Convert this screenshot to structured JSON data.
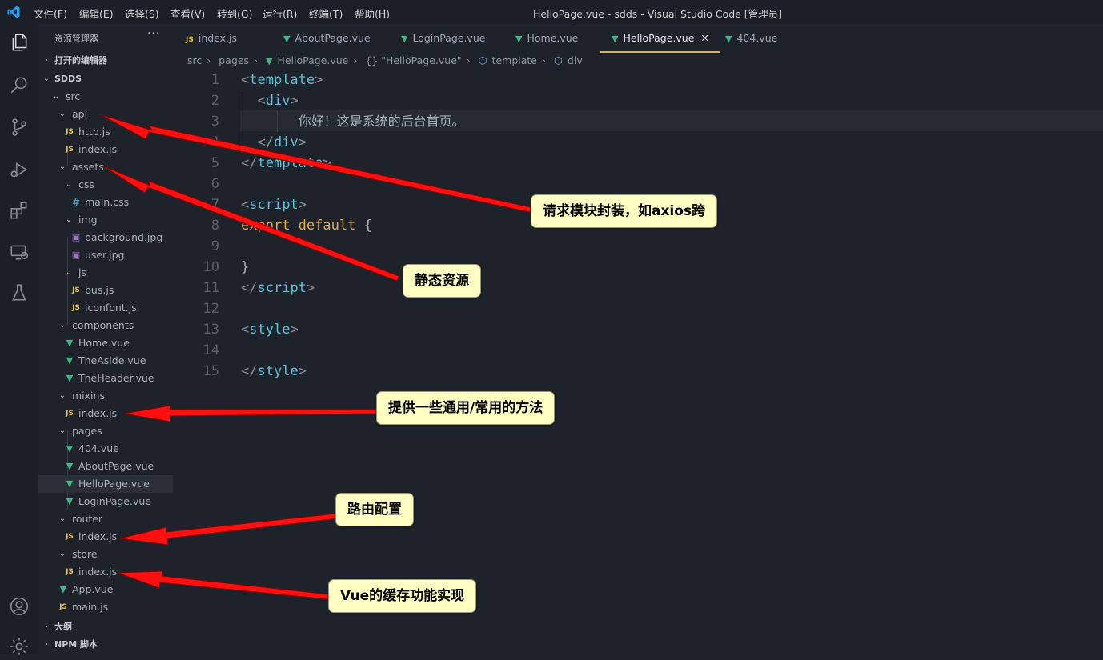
{
  "menu": [
    "文件(F)",
    "编辑(E)",
    "选择(S)",
    "查看(V)",
    "转到(G)",
    "运行(R)",
    "终端(T)",
    "帮助(H)"
  ],
  "window_title": "HelloPage.vue - sdds - Visual Studio Code [管理员]",
  "sidebar": {
    "title": "资源管理器",
    "more": "···",
    "open_editors": "打开的编辑器",
    "project": "SDDS",
    "outline": "大纲",
    "npm": "NPM 脚本",
    "tree": {
      "src": "src",
      "api": "api",
      "http": "http.js",
      "api_index": "index.js",
      "assets": "assets",
      "css": "css",
      "main_css": "main.css",
      "img": "img",
      "bg": "background.jpg",
      "user": "user.jpg",
      "js": "js",
      "bus": "bus.js",
      "iconfont": "iconfont.js",
      "components": "components",
      "home": "Home.vue",
      "aside": "TheAside.vue",
      "header": "TheHeader.vue",
      "mixins": "mixins",
      "mixins_index": "index.js",
      "pages": "pages",
      "p404": "404.vue",
      "about": "AboutPage.vue",
      "hello": "HelloPage.vue",
      "login": "LoginPage.vue",
      "router": "router",
      "router_index": "index.js",
      "store": "store",
      "store_index": "index.js",
      "app": "App.vue",
      "main_js": "main.js"
    }
  },
  "tabs": [
    "index.js",
    "AboutPage.vue",
    "LoginPage.vue",
    "Home.vue",
    "HelloPage.vue",
    "404.vue"
  ],
  "breadcrumb": [
    "src",
    "pages",
    "HelloPage.vue",
    "{} \"HelloPage.vue\"",
    "template",
    "div"
  ],
  "editor": {
    "line_numbers": [
      "1",
      "2",
      "3",
      "4",
      "5",
      "6",
      "7",
      "8",
      "9",
      "10",
      "11",
      "12",
      "13",
      "14",
      "15"
    ],
    "greeting": "你好！这是系统的后台首页。",
    "template_tag": "template",
    "div_tag": "div",
    "script_tag": "script",
    "style_tag": "style",
    "export": "export",
    "default": "default",
    "open_brace": "{",
    "close_brace": "}"
  },
  "annotations": {
    "api": "请求模块封装，如axios跨",
    "assets": "静态资源",
    "mixins": "提供一些通用/常用的方法",
    "router": "路由配置",
    "store": "Vue的缓存功能实现"
  },
  "icons": {
    "js": "JS",
    "css": "#",
    "vue": "▼",
    "expanded": "⌄",
    "collapsed": "›"
  },
  "colors": {
    "background": "#1e222b",
    "active_tab_underline": "#d9b44a",
    "callout_fill": "#ffffc4",
    "arrow": "#ff0000"
  }
}
